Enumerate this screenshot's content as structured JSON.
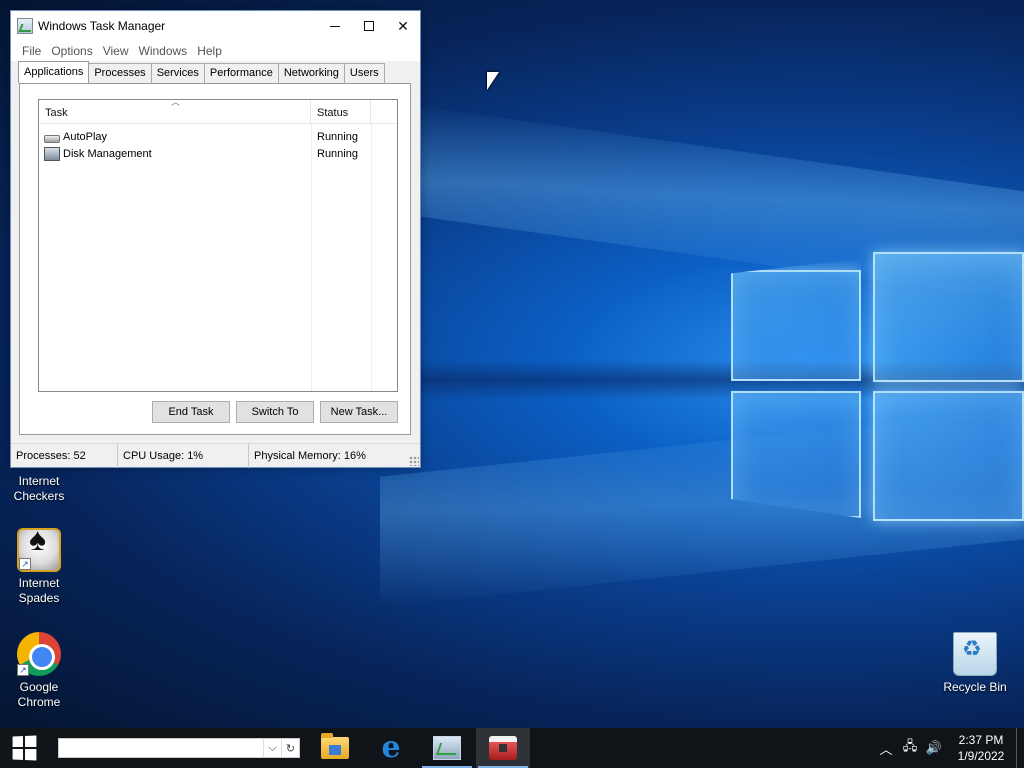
{
  "window": {
    "title": "Windows Task Manager",
    "menu": [
      "File",
      "Options",
      "View",
      "Windows",
      "Help"
    ],
    "tabs": [
      "Applications",
      "Processes",
      "Services",
      "Performance",
      "Networking",
      "Users"
    ],
    "active_tab": "Applications",
    "list": {
      "columns": [
        "Task",
        "Status"
      ],
      "rows": [
        {
          "task": "AutoPlay",
          "status": "Running",
          "icon": "drive-icon"
        },
        {
          "task": "Disk Management",
          "status": "Running",
          "icon": "disk-management-icon"
        }
      ]
    },
    "buttons": {
      "end_task": "End Task",
      "switch_to": "Switch To",
      "new_task": "New Task..."
    },
    "status": {
      "processes": "Processes: 52",
      "cpu": "CPU Usage: 1%",
      "memory": "Physical Memory: 16%"
    }
  },
  "desktop": {
    "icons": [
      {
        "label_line1": "Internet",
        "label_line2": "Checkers"
      },
      {
        "label_line1": "Internet",
        "label_line2": "Spades"
      },
      {
        "label_line1": "Google",
        "label_line2": "Chrome"
      },
      {
        "label_line1": "Recycle Bin",
        "label_line2": ""
      }
    ]
  },
  "taskbar": {
    "search_placeholder": "",
    "clock_time": "2:37 PM",
    "clock_date": "1/9/2022",
    "apps": [
      "file-explorer-icon",
      "edge-icon",
      "task-manager-icon",
      "toolbox-icon"
    ]
  },
  "colors": {
    "accent": "#0078d7",
    "taskbar": "#101418",
    "running_indicator": "#7eb4ea"
  }
}
